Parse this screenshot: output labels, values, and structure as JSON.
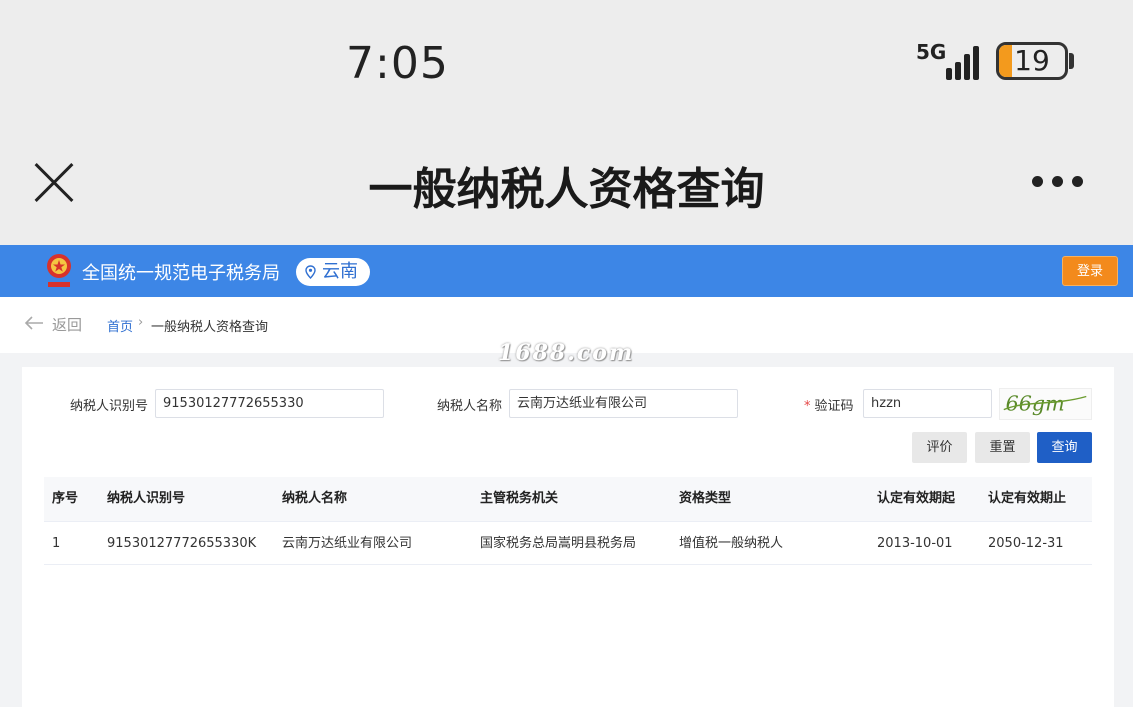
{
  "status": {
    "time": "7:05",
    "network": "5G",
    "battery": "19",
    "battery_level": 0.19
  },
  "nav": {
    "title": "一般纳税人资格查询",
    "close_icon": "close-icon",
    "more_icon": "more-dots-icon"
  },
  "banner": {
    "site_name": "全国统一规范电子税务局",
    "region": "云南",
    "login": "登录",
    "brand_color": "#3d86e6",
    "login_color": "#f38a1c"
  },
  "breadcrumb": {
    "back": "返回",
    "home": "首页",
    "separator": "›",
    "current": "一般纳税人资格查询"
  },
  "watermark": "1688.com",
  "form": {
    "tax_id_label": "纳税人识别号",
    "tax_id_value": "91530127772655330",
    "name_label": "纳税人名称",
    "name_value": "云南万达纸业有限公司",
    "required_mark": "*",
    "captcha_label": "验证码",
    "captcha_value": "hzzn",
    "captcha_image_text": "66gm",
    "buttons": {
      "rate": "评价",
      "reset": "重置",
      "query": "查询"
    }
  },
  "table": {
    "headers": [
      "序号",
      "纳税人识别号",
      "纳税人名称",
      "主管税务机关",
      "资格类型",
      "认定有效期起",
      "认定有效期止"
    ],
    "rows": [
      [
        "1",
        "91530127772655330K",
        "云南万达纸业有限公司",
        "国家税务总局嵩明县税务局",
        "增值税一般纳税人",
        "2013-10-01",
        "2050-12-31"
      ]
    ]
  }
}
